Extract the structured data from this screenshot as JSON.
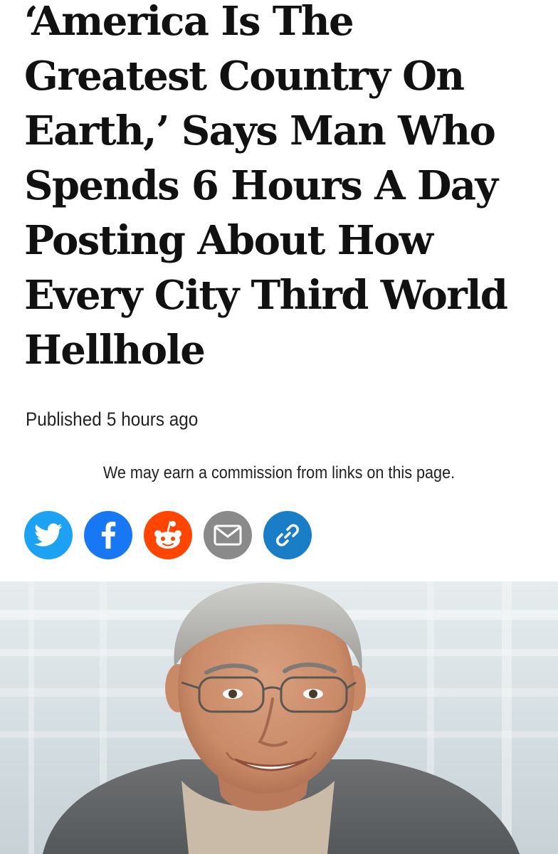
{
  "article": {
    "headline": "‘America Is The Greatest Country On Earth,’ Says Man Who Spends 6 Hours A Day Posting About How Every City Third World Hellhole",
    "published_label": "Published",
    "published_time": "5 hours ago",
    "disclaimer": "We may earn a commission from links on this page."
  },
  "share": {
    "buttons": [
      {
        "name": "twitter",
        "icon": "twitter-bird-icon",
        "color": "#1da1f2"
      },
      {
        "name": "facebook",
        "icon": "facebook-f-icon",
        "color": "#1877f2"
      },
      {
        "name": "reddit",
        "icon": "reddit-alien-icon",
        "color": "#ff4500"
      },
      {
        "name": "email",
        "icon": "envelope-icon",
        "color": "#8a8a8a"
      },
      {
        "name": "copy-link",
        "icon": "chain-link-icon",
        "color": "#1a7ec7"
      }
    ]
  },
  "hero_image": {
    "subject": "smiling gray-haired man with glasses"
  }
}
